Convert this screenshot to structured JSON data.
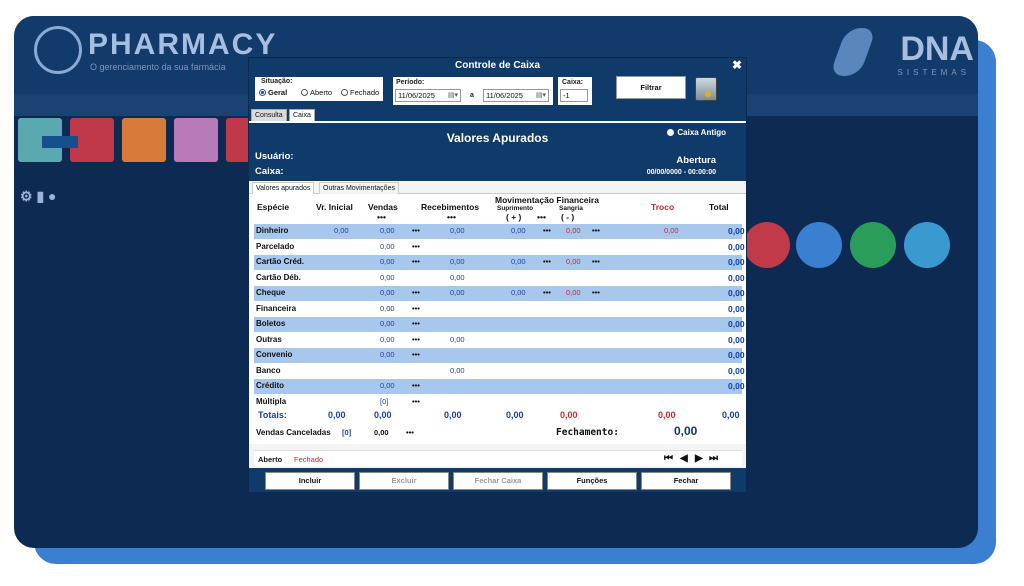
{
  "background": {
    "logo_text": "PHARMACY",
    "logo_sub": "O gerenciamento da sua farmácia",
    "dna_text": "DNA",
    "dna_sub": "SISTEMAS"
  },
  "dialog": {
    "title": "Controle de Caixa",
    "close_icon": "close-icon",
    "filters": {
      "situacao_label": "Situação:",
      "situacao_options": [
        "Geral",
        "Aberto",
        "Fechado"
      ],
      "situacao_selected": "Geral",
      "periodo_label": "Período:",
      "date_from": "11/06/2025",
      "date_sep": "a",
      "date_to": "11/06/2025",
      "caixa_label": "Caixa:",
      "caixa_value": "-1",
      "filtrar_label": "Filtrar"
    },
    "top_tabs": [
      "Consulta",
      "Caixa"
    ],
    "panel": {
      "title": "Valores Apurados",
      "caixa_antigo": "Caixa Antigo",
      "usuario_label": "Usuário:",
      "caixa_label": "Caixa:",
      "abertura_label": "Abertura",
      "abertura_value": "00/00/0000 - 00:00:00"
    },
    "inner_tabs": [
      "Valores apurados",
      "Outras Movimentações"
    ],
    "headers": {
      "especie": "Espécie",
      "vr_inicial": "Vr. Inicial",
      "vendas": "Vendas",
      "recebimentos": "Recebimentos",
      "mov_fin": "Movimentação Financeira",
      "suprimento": "Suprimento",
      "suprimento_sign": "( + )",
      "sangria": "Sangria",
      "sangria_sign": "( - )",
      "troco": "Troco",
      "total": "Total",
      "dots": "•••"
    },
    "rows": [
      {
        "name": "Dinheiro",
        "vr_inicial": "0,00",
        "vendas": "0,00",
        "v_dots": "•••",
        "receb": "0,00",
        "sup": "0,00",
        "s_dots": "•••",
        "sang": "0,00",
        "g_dots": "•••",
        "troco": "0,00",
        "total": "0,00"
      },
      {
        "name": "Parcelado",
        "vendas": "0,00",
        "v_dots": "•••",
        "total": "0,00"
      },
      {
        "name": "Cartão Créd.",
        "vendas": "0,00",
        "v_dots": "•••",
        "receb": "0,00",
        "sup": "0,00",
        "s_dots": "•••",
        "sang": "0,00",
        "g_dots": "•••",
        "total": "0,00"
      },
      {
        "name": "Cartão Déb.",
        "vendas": "0,00",
        "receb": "0,00",
        "total": "0,00"
      },
      {
        "name": "Cheque",
        "vendas": "0,00",
        "v_dots": "•••",
        "receb": "0,00",
        "sup": "0,00",
        "s_dots": "•••",
        "sang": "0,00",
        "g_dots": "•••",
        "total": "0,00"
      },
      {
        "name": "Financeira",
        "vendas": "0,00",
        "v_dots": "•••",
        "total": "0,00"
      },
      {
        "name": "Boletos",
        "vendas": "0,00",
        "v_dots": "•••",
        "total": "0,00"
      },
      {
        "name": "Outras",
        "vendas": "0,00",
        "v_dots": "•••",
        "receb": "0,00",
        "total": "0,00"
      },
      {
        "name": "Convenio",
        "vendas": "0,00",
        "v_dots": "•••",
        "total": "0,00"
      },
      {
        "name": "Banco",
        "receb": "0,00",
        "total": "0,00"
      },
      {
        "name": "Crédito",
        "vendas": "0,00",
        "v_dots": "•••",
        "total": "0,00"
      },
      {
        "name": "Múltipla",
        "vendas": "[0]",
        "v_dots": "•••"
      }
    ],
    "totals": {
      "label": "Totais:",
      "vr_inicial": "0,00",
      "vendas": "0,00",
      "receb": "0,00",
      "sup": "0,00",
      "sang": "0,00",
      "troco": "0,00",
      "total": "0,00"
    },
    "canceladas": {
      "label": "Vendas Canceladas",
      "count": "[0]",
      "value": "0,00",
      "dots": "•••",
      "fechamento_label": "Fechamento:",
      "fechamento_value": "0,00"
    },
    "legend": {
      "aberto": "Aberto",
      "fechado": "Fechado"
    },
    "nav_icons": [
      "first-icon",
      "prev-icon",
      "next-icon",
      "last-icon"
    ],
    "buttons": {
      "incluir": "Incluir",
      "excluir": "Excluir",
      "fechar_caixa": "Fechar Caixa",
      "funcoes": "Funções",
      "fechar": "Fechar"
    },
    "colors": {
      "dark_blue": "#0f3a6a",
      "row_alt": "#a8c7ec",
      "value_blue": "#1a3fb0",
      "red": "#cc2a2a"
    }
  }
}
